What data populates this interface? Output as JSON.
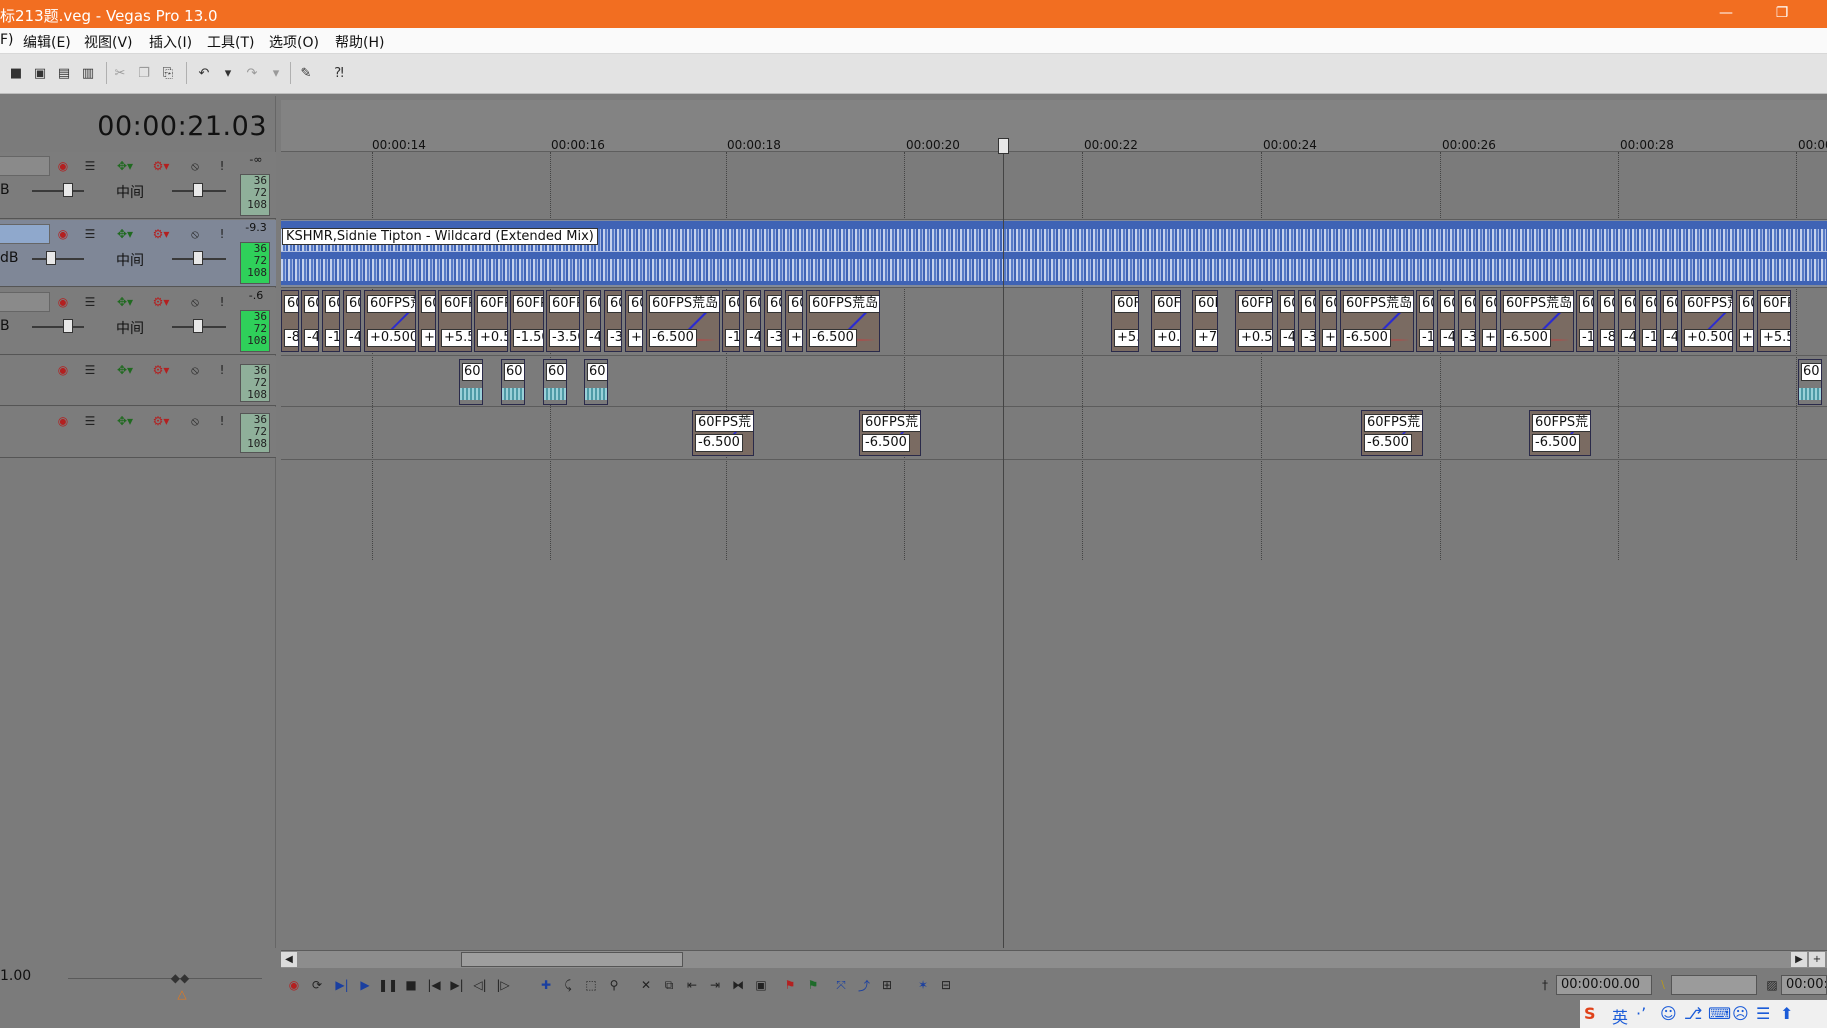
{
  "window": {
    "title": "标213题.veg - Vegas Pro 13.0",
    "minimize_icon": "minimize-icon",
    "restore_icon": "restore-icon",
    "minimize_glyph": "—",
    "restore_glyph": "❐"
  },
  "menu": [
    {
      "label": "F)"
    },
    {
      "label": "编辑(E)"
    },
    {
      "label": "视图(V)"
    },
    {
      "label": "插入(I)"
    },
    {
      "label": "工具(T)"
    },
    {
      "label": "选项(O)"
    },
    {
      "label": "帮助(H)"
    }
  ],
  "toolbar": {
    "icons": [
      "save-icon",
      "save-as-icon",
      "render-icon",
      "properties-icon",
      "cut-icon",
      "copy-icon",
      "paste-icon",
      "undo-icon",
      "undo-dropdown-icon",
      "redo-icon",
      "redo-dropdown-icon",
      "paint-icon",
      "help-pointer-icon"
    ],
    "glyphs": [
      "■",
      "▣",
      "▤",
      "▥",
      "✂",
      "❐",
      "⎘",
      "↶",
      "▾",
      "↷",
      "▾",
      "✎",
      "⁈"
    ]
  },
  "timecode": "00:00:21.03",
  "tracks": [
    {
      "volume_value": "-∞",
      "meter": [
        "36",
        "72",
        "108"
      ],
      "gain_label": "B",
      "pan_label": "中间"
    },
    {
      "volume_value": "-9.3",
      "meter": [
        "36",
        "72",
        "108"
      ],
      "gain_label": "dB",
      "pan_label": "中间"
    },
    {
      "volume_value": "-.6",
      "meter": [
        "36",
        "72",
        "108"
      ],
      "gain_label": "B",
      "pan_label": "中间"
    },
    {
      "volume_value": "",
      "meter": [
        "36",
        "72",
        "108"
      ],
      "gain_label": "",
      "pan_label": ""
    },
    {
      "volume_value": "",
      "meter": [
        "36",
        "72",
        "108"
      ],
      "gain_label": "",
      "pan_label": ""
    }
  ],
  "track_icons": {
    "record": "◉",
    "mixer": "☰",
    "fx": "✥▾",
    "gear": "⚙▾",
    "mute": "⦸",
    "solo": "!"
  },
  "playback_rate": "1.00",
  "ruler": [
    "00:00:14",
    "00:00:16",
    "00:00:18",
    "00:00:20",
    "00:00:22",
    "00:00:24",
    "00:00:26",
    "00:00:28",
    "00:00"
  ],
  "audio_clip": {
    "label": "KSHMR,Sidnie Tipton - Wildcard (Extended Mix)"
  },
  "track3_clips": [
    {
      "top": "60",
      "bot": "-8"
    },
    {
      "top": "60",
      "bot": "-4"
    },
    {
      "top": "60",
      "bot": "-1"
    },
    {
      "top": "60",
      "bot": "-4"
    },
    {
      "top": "60FPS荒",
      "bot": "+0.500"
    },
    {
      "top": "60",
      "bot": "+0"
    },
    {
      "top": "60FP",
      "bot": "+5.5"
    },
    {
      "top": "60FP",
      "bot": "+0.5"
    },
    {
      "top": "60FP",
      "bot": "-1.50"
    },
    {
      "top": "60FP",
      "bot": "-3.50"
    },
    {
      "top": "60",
      "bot": "-4"
    },
    {
      "top": "60",
      "bot": "-3"
    },
    {
      "top": "60",
      "bot": "+("
    },
    {
      "top": "60FPS荒岛",
      "bot": "-6.500"
    },
    {
      "top": "60",
      "bot": "-1"
    },
    {
      "top": "60",
      "bot": "-4"
    },
    {
      "top": "60",
      "bot": "-3"
    },
    {
      "top": "60",
      "bot": "+"
    },
    {
      "top": "60FPS荒岛",
      "bot": "-6.500"
    },
    {
      "top": "60F",
      "bot": "+5."
    },
    {
      "top": "60F",
      "bot": "+0."
    },
    {
      "top": "60F",
      "bot": "+7"
    },
    {
      "top": "60FP",
      "bot": "+0.50"
    },
    {
      "top": "60",
      "bot": "-4"
    },
    {
      "top": "60",
      "bot": "-3"
    },
    {
      "top": "60",
      "bot": "+("
    },
    {
      "top": "60FPS荒岛",
      "bot": "-6.500"
    },
    {
      "top": "60",
      "bot": "-1"
    },
    {
      "top": "60",
      "bot": "-4"
    },
    {
      "top": "60",
      "bot": "-3"
    },
    {
      "top": "60",
      "bot": "+"
    },
    {
      "top": "60FPS荒岛",
      "bot": "-6.500"
    },
    {
      "top": "60",
      "bot": "-1"
    },
    {
      "top": "60",
      "bot": "-8"
    },
    {
      "top": "60",
      "bot": "-4"
    },
    {
      "top": "60",
      "bot": "-1"
    },
    {
      "top": "60",
      "bot": "-4"
    },
    {
      "top": "60FPS荒",
      "bot": "+0.500"
    },
    {
      "top": "60",
      "bot": "+("
    },
    {
      "top": "60FP",
      "bot": "+5.5"
    }
  ],
  "track4_clips": [
    {
      "top": "60"
    },
    {
      "top": "60"
    },
    {
      "top": "60"
    },
    {
      "top": "60"
    },
    {
      "top": "60"
    }
  ],
  "track5_clips": [
    {
      "top": "60FPS荒",
      "bot": "-6.500"
    },
    {
      "top": "60FPS荒",
      "bot": "-6.500"
    },
    {
      "top": "60FPS荒",
      "bot": "-6.500"
    },
    {
      "top": "60FPS荒",
      "bot": "-6.500"
    }
  ],
  "transport": {
    "icons": [
      "record-icon",
      "loop-icon",
      "play-from-start-icon",
      "play-icon",
      "pause-icon",
      "stop-icon",
      "go-to-start-icon",
      "go-to-end-icon",
      "previous-frame-icon",
      "next-frame-icon"
    ],
    "glyphs": [
      "◉",
      "⟳",
      "▶|",
      "▶",
      "❚❚",
      "■",
      "|◀",
      "▶|",
      "◁|",
      "|▷"
    ],
    "edit_icons": [
      "normal-edit-tool-icon",
      "envelope-tool-icon",
      "selection-tool-icon",
      "zoom-tool-icon",
      "delete-icon",
      "trim-icon",
      "trim-start-icon",
      "trim-end-icon",
      "split-icon",
      "lock-icon",
      "marker-icon",
      "region-icon",
      "snap-icon",
      "auto-ripple-icon",
      "grouping-icon",
      "crossfade-icon",
      "grid-icon"
    ],
    "edit_glyphs": [
      "✚",
      "⤹",
      "⬚",
      "⚲",
      "✕",
      "⧉",
      "⇤",
      "⇥",
      "⧓",
      "▣",
      "⚑",
      "⚑",
      "⤧",
      "⤴",
      "⊞",
      "✶",
      "⊟"
    ],
    "cursor_time": "00:00:00.00",
    "end_time": "00:00:"
  },
  "taskbar": {
    "items": [
      "S",
      "英",
      "·’",
      "☺",
      "⎇",
      "⌨",
      "☹",
      "☰",
      "⬆"
    ]
  },
  "colors": {
    "title_bar": "#f26e21",
    "audio_clip": "#3f63b5",
    "meter_active": "#2fd05a"
  }
}
